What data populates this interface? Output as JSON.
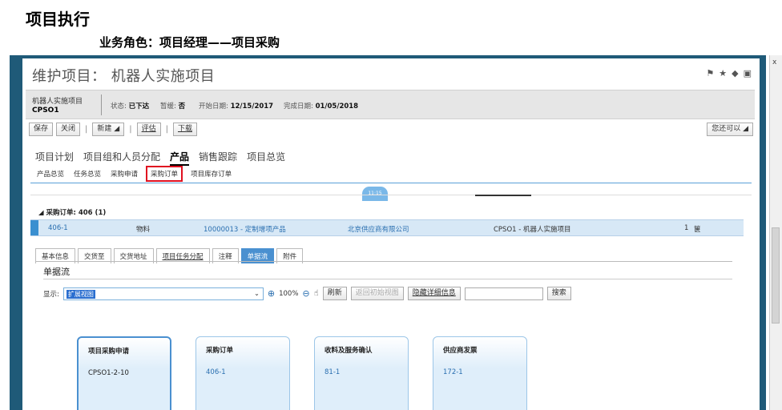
{
  "slide": {
    "title": "项目执行",
    "subtitle": "业务角色：项目经理——项目采购"
  },
  "window": {
    "title": "维护项目： 机器人实施项目",
    "close_label": "x"
  },
  "info": {
    "project_name": "机器人实施项目",
    "project_id": "CPSO1",
    "status_label": "状态:",
    "status_value": "已下达",
    "hold_label": "暂缓:",
    "hold_value": "否",
    "start_label": "开始日期:",
    "start_value": "12/15/2017",
    "end_label": "完成日期:",
    "end_value": "01/05/2018"
  },
  "toolbar": {
    "save": "保存",
    "close": "关闭",
    "new": "新建",
    "evaluate": "评估",
    "download": "下载",
    "more": "您还可以"
  },
  "main_tabs": [
    "项目计划",
    "项目组和人员分配",
    "产品",
    "销售跟踪",
    "项目总览"
  ],
  "sub_tabs": [
    "产品总览",
    "任务总览",
    "采购申请",
    "采购订单",
    "项目库存订单"
  ],
  "badge": "11:15",
  "group": {
    "label": "采购订单: 406 (1)"
  },
  "row": {
    "id": "406-1",
    "type": "物料",
    "product": "10000013 - 定制增项产品",
    "supplier": "北京供应商有限公司",
    "project": "CPSO1 - 机器人实施项目",
    "qty": "1",
    "unit": "箧"
  },
  "detail_tabs": [
    "基本信息",
    "交货至",
    "交货地址",
    "项目任务分配",
    "注释",
    "单据流",
    "附件"
  ],
  "section": {
    "title": "单据流",
    "display_label": "显示:",
    "display_value": "扩展视图",
    "zoom": "100%",
    "refresh": "刷新",
    "back": "返回初始视图",
    "hide": "隐藏详细信息",
    "search": "搜索"
  },
  "cards": [
    {
      "title": "项目采购申请",
      "value": "CPSO1-2-10"
    },
    {
      "title": "采购订单",
      "value": "406-1"
    },
    {
      "title": "收料及服务确认",
      "value": "81-1"
    },
    {
      "title": "供应商发票",
      "value": "172-1"
    }
  ]
}
